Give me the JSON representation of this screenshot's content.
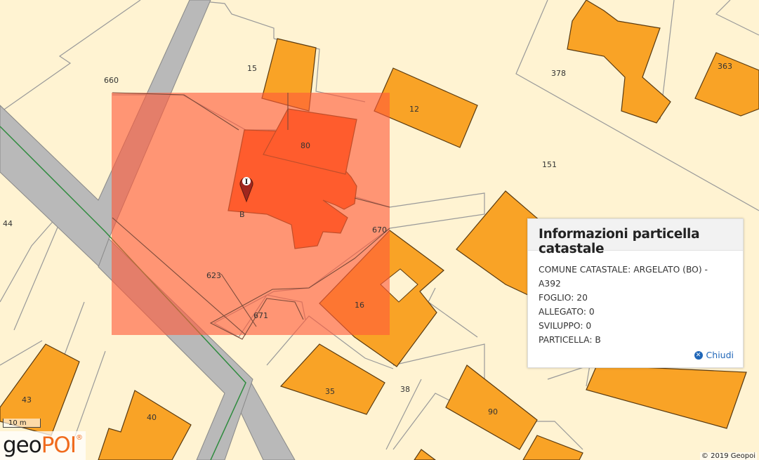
{
  "map": {
    "parcel_labels": [
      "660",
      "15",
      "12",
      "378",
      "363",
      "80",
      "151",
      "44",
      "670",
      "623",
      "671",
      "16",
      "43",
      "40",
      "35",
      "38",
      "90"
    ],
    "selected_parcel_label": "B",
    "marker_label": "I"
  },
  "popup": {
    "title": "Informazioni particella catastale",
    "lines": [
      "COMUNE CATASTALE: ARGELATO (BO) - A392",
      "FOGLIO: 20",
      "ALLEGATO: 0",
      "SVILUPPO: 0",
      "PARTICELLA: B"
    ],
    "close_label": "Chiudi"
  },
  "scale": {
    "label": "10 m"
  },
  "logo": {
    "part1": "geo",
    "part2": "POI",
    "mark": "®"
  },
  "copyright": "© 2019 Geopoi",
  "colors": {
    "background": "#fff3d2",
    "building": "#f9a326",
    "selection": "#ff5a3a",
    "road": "#b9b9b9",
    "accent": "#1f66b8"
  }
}
